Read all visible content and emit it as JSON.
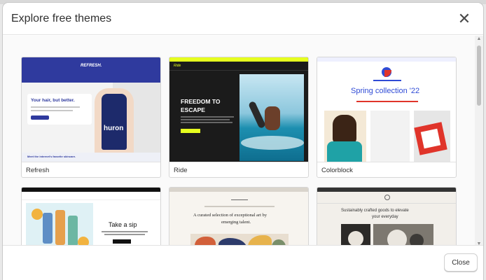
{
  "modal": {
    "title": "Explore free themes",
    "close_label": "Close"
  },
  "themes": [
    {
      "name": "Refresh",
      "brand": "REFRESH.",
      "headline": "Your hair, but better.",
      "product": "huron",
      "caption": "Meet the internet's favorite skincare."
    },
    {
      "name": "Ride",
      "headline_1": "FREEDOM TO",
      "headline_2": "ESCAPE",
      "logo": "Ride"
    },
    {
      "name": "Colorblock",
      "headline": "Spring collection '22"
    },
    {
      "name": "",
      "headline": "Take a sip"
    },
    {
      "name": "",
      "headline_1": "A curated selection of exceptional art by",
      "headline_2": "emerging talent."
    },
    {
      "name": "",
      "headline_1": "Sustainably crafted goods to elevate",
      "headline_2": "your everyday"
    }
  ],
  "colors": {
    "accent": "#2f3a9e",
    "ride_yellow": "#e6ff1f",
    "colorblock_red": "#e0342a"
  }
}
